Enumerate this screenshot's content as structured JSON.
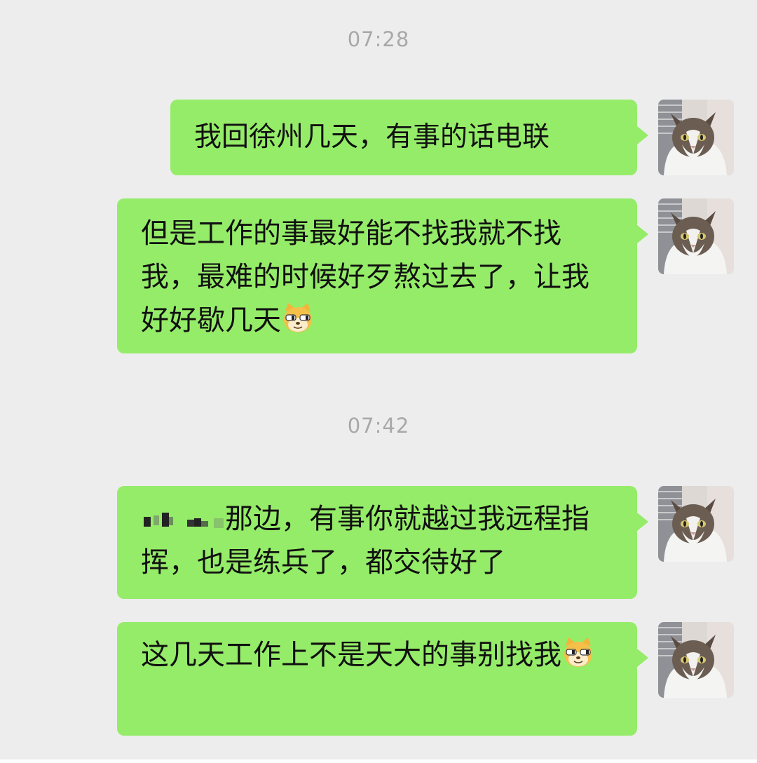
{
  "timestamps": [
    "07:28",
    "07:42"
  ],
  "messages": [
    {
      "text": "我回徐州几天，有事的话电联",
      "emoji": ""
    },
    {
      "text": "但是工作的事最好能不找我就不找我，最难的时候好歹熬过去了，让我好好歇几天",
      "emoji": "doge-emoji"
    },
    {
      "redacted_prefix": "blurred-text",
      "text": "那边，有事你就越过我远程指挥，也是练兵了，都交待好了",
      "emoji": ""
    },
    {
      "text": "这几天工作上不是天大的事别找我",
      "emoji": "doge-emoji"
    }
  ],
  "colors": {
    "background": "#ededed",
    "bubble": "#95ec69",
    "timestamp": "#a8a8a8",
    "text": "#111111"
  },
  "avatar": "cat-avatar"
}
